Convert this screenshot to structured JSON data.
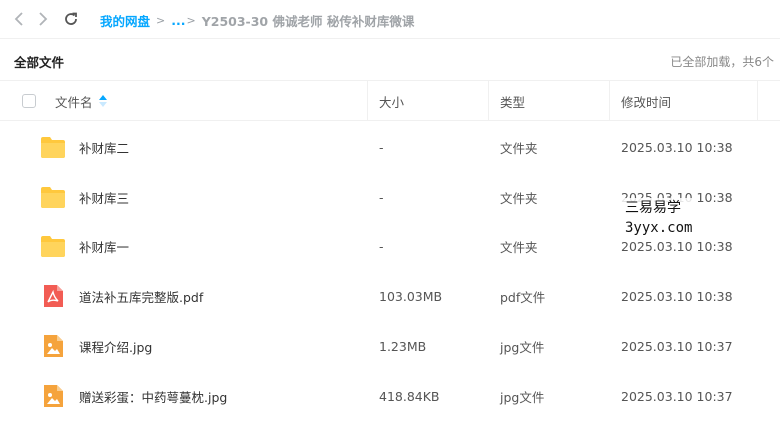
{
  "nav": {
    "back_icon": "chevron-left-icon",
    "forward_icon": "chevron-right-icon",
    "refresh_icon": "refresh-icon"
  },
  "breadcrumb": {
    "root": "我的网盘",
    "more": "...",
    "current": "Y2503-30 佛诚老师 秘传补财库微课"
  },
  "section": {
    "title": "全部文件",
    "load_status": "已全部加载，共6个"
  },
  "table": {
    "columns": {
      "name": "文件名",
      "size": "大小",
      "type": "类型",
      "modified": "修改时间"
    },
    "rows": [
      {
        "icon": "folder-icon",
        "name": "补财库二",
        "size": "-",
        "type": "文件夹",
        "modified": "2025.03.10 10:38"
      },
      {
        "icon": "folder-icon",
        "name": "补财库三",
        "size": "-",
        "type": "文件夹",
        "modified": "2025.03.10 10:38"
      },
      {
        "icon": "folder-icon",
        "name": "补财库一",
        "size": "-",
        "type": "文件夹",
        "modified": "2025.03.10 10:38"
      },
      {
        "icon": "pdf-file-icon",
        "name": "道法补五库完整版.pdf",
        "size": "103.03MB",
        "type": "pdf文件",
        "modified": "2025.03.10 10:38"
      },
      {
        "icon": "image-file-icon",
        "name": "课程介绍.jpg",
        "size": "1.23MB",
        "type": "jpg文件",
        "modified": "2025.03.10 10:37"
      },
      {
        "icon": "image-file-icon",
        "name": "赠送彩蛋：中药萼蔓枕.jpg",
        "size": "418.84KB",
        "type": "jpg文件",
        "modified": "2025.03.10 10:37"
      }
    ]
  },
  "watermark": {
    "line1": "三易易学",
    "line2": "3yyx.com"
  },
  "colors": {
    "accent": "#06a7ff",
    "folder": "#ffc83d",
    "pdf": "#f25c54",
    "image": "#f5a33c"
  }
}
